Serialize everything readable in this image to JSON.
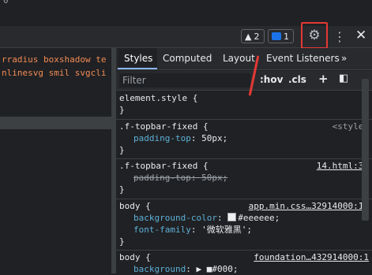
{
  "top": {
    "partial_text": "0"
  },
  "toolbar": {
    "warnings_count": "2",
    "messages_count": "1",
    "settings_icon": "⚙",
    "more_icon": "⋮",
    "close_icon": "✕"
  },
  "left": {
    "code_lines": [
      "rradius boxshadow te",
      "nlinesvg smil svgcli"
    ]
  },
  "tabs": [
    "Styles",
    "Computed",
    "Layout",
    "Event Listeners",
    "»"
  ],
  "filter": {
    "placeholder": "Filter",
    "hov": ":hov",
    "cls": ".cls",
    "add": "+",
    "toggle": "◧"
  },
  "rules": [
    {
      "selector": "element.style {",
      "close": "}",
      "source": "",
      "props": []
    },
    {
      "selector": ".f-topbar-fixed {",
      "close": "}",
      "source": "<style>",
      "props": [
        {
          "name": "padding-top",
          "value": "50px;"
        }
      ]
    },
    {
      "selector": ".f-topbar-fixed {",
      "close": "}",
      "source": "14.html:31",
      "props": [
        {
          "name": "padding-top",
          "value": "50px;"
        }
      ]
    },
    {
      "selector": "body {",
      "close": "}",
      "source": "app.min.css…32914000:14",
      "props": [
        {
          "name": "background-color",
          "value": "#eeeeee;"
        },
        {
          "name": "font-family",
          "value": "'微软雅黑';"
        }
      ]
    },
    {
      "selector": "body {",
      "close": "",
      "source": "foundation…432914000:1",
      "props": [
        {
          "name": "background",
          "value": "▶ ■#000;"
        }
      ]
    }
  ],
  "colors": {
    "accent": "#8ab4f8",
    "highlight": "#e53935",
    "property": "#5db0d7"
  }
}
